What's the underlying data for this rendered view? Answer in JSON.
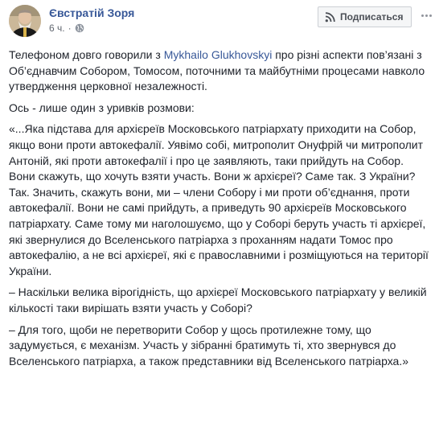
{
  "author": {
    "name": "Євстратій Зоря"
  },
  "meta": {
    "time": "6 ч.",
    "separator": "·",
    "audience_icon": "globe-icon"
  },
  "subscribe": {
    "label": "Подписаться",
    "icon": "rss-icon"
  },
  "more": {
    "icon": "more-options-icon"
  },
  "post": {
    "p1_before": "Телефоном довго говорили з ",
    "p1_mention": "Mykhailo Glukhovskyi",
    "p1_after": " про різні аспекти пов’язані з Об’єднавчим Собором, Томосом, поточними та майбутніми процесами навколо утвердження церковної незалежності.",
    "p2": "Ось - лише один з уривків розмови:",
    "p3": "«...Яка підстава для архієреїв Московського патріархату приходити на Собор, якщо вони проти автокефалії. Уявімо собі, митрополит Онуфрій чи митрополит Антоній, які проти автокефалії і про це заявляють, таки прийдуть на Собор. Вони скажуть, що хочуть взяти участь. Вони ж архієреї? Саме так. З України? Так. Значить, скажуть вони, ми – члени Собору і ми проти об’єднання, проти автокефалії. Вони не самі прийдуть, а приведуть 90 архієреїв Московського патріархату. Саме тому ми наголошуємо, що у Соборі беруть участь ті архієреї, які звернулися до Вселенського патріарха з проханням надати Томос про автокефалію, а не всі архієреї, які є православними і розміщуються на території України.",
    "p4": "– Наскільки велика вірогідність, що архієреї Московського патріархату у великій кількості таки вирішать взяти участь у Соборі?",
    "p5": "– Для того, щоби не перетворити Собор у щось протилежне тому, що задумується, є механізм. Участь у зібранні братимуть ті, хто звернувся до Вселенського патріарха, а також представники від Вселенського патріарха.»"
  }
}
